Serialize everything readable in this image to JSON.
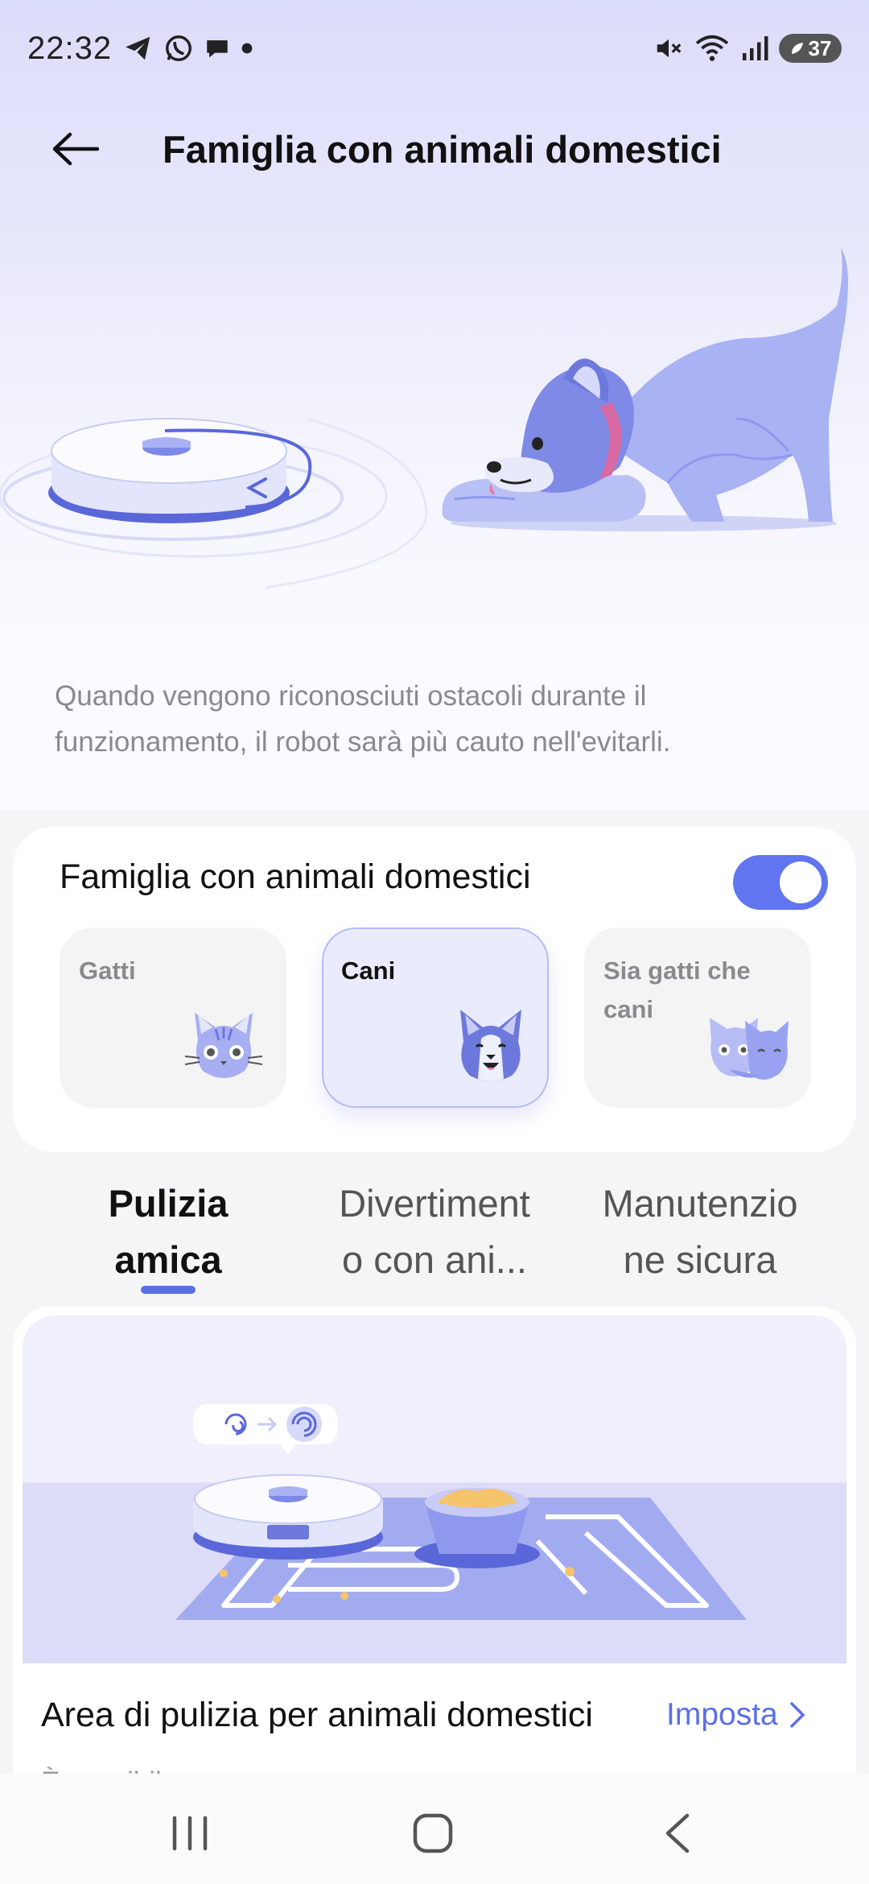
{
  "status_bar": {
    "time": "22:32",
    "battery": "37",
    "left_icons": [
      "telegram-icon",
      "whatsapp-icon",
      "chat-bubble-icon",
      "dot-icon"
    ],
    "right_icons": [
      "mute-icon",
      "wifi-icon",
      "signal-icon",
      "battery-icon"
    ]
  },
  "header": {
    "title": "Famiglia con animali domestici",
    "back_icon": "arrow-left-icon"
  },
  "description": "Quando vengono riconosciuti ostacoli durante il funzionamento, il robot sarà più cauto nell'evitarli.",
  "settings_card": {
    "title": "Famiglia con animali domestici",
    "toggle_on": true,
    "options": [
      {
        "label": "Gatti",
        "selected": false,
        "icon": "cat-icon"
      },
      {
        "label": "Cani",
        "selected": true,
        "icon": "dog-icon"
      },
      {
        "label": "Sia gatti che cani",
        "selected": false,
        "icon": "cat-and-dog-icon"
      }
    ]
  },
  "tabs": [
    {
      "line1": "Pulizia",
      "line2": "amica",
      "active": true
    },
    {
      "line1": "Divertiment",
      "line2": "o con ani...",
      "active": false
    },
    {
      "line1": "Manutenzio",
      "line2": "ne sicura",
      "active": false
    }
  ],
  "feature": {
    "title": "Area di pulizia per animali domestici",
    "action_label": "Imposta",
    "subtitle": "È possibile ... ... ... ... ... ..."
  },
  "colors": {
    "accent": "#5b6fe6",
    "toggle": "#6075ef",
    "illustration": "#8e99ee"
  },
  "nav_bar": [
    "recent-apps-icon",
    "home-icon",
    "back-icon"
  ]
}
